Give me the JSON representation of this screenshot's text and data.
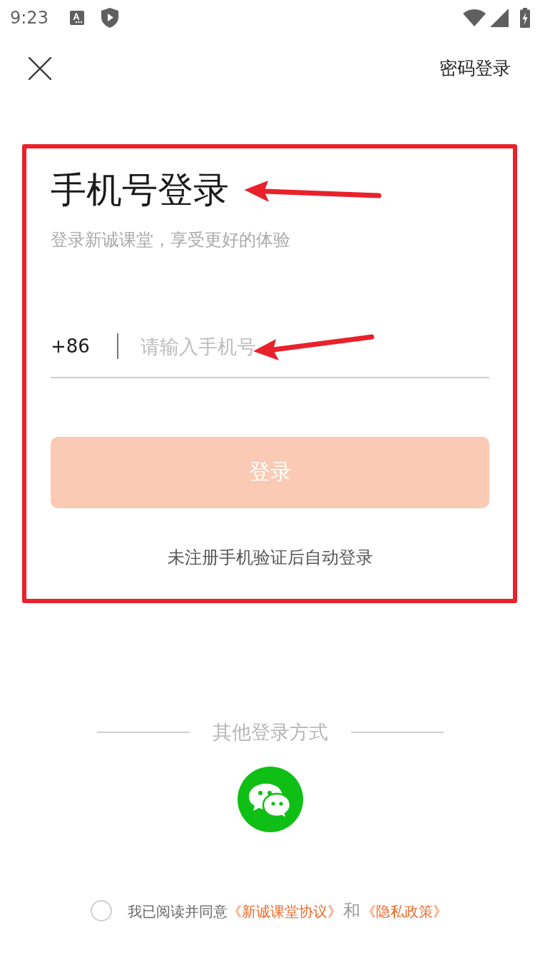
{
  "status_bar": {
    "time": "9:23"
  },
  "top_bar": {
    "password_login": "密码登录"
  },
  "login_card": {
    "highlighted": true,
    "title": "手机号登录",
    "subtitle": "登录新诚课堂，享受更好的体验",
    "country_code": "+86",
    "phone_field": {
      "placeholder": "请输入手机号"
    },
    "login_button": {
      "label": "登录",
      "disabled": true
    },
    "note": "未注册手机验证后自动登录"
  },
  "annotation_arrows": [
    {
      "kind": "arrow"
    },
    {
      "kind": "arrow"
    }
  ],
  "other_login": {
    "title": "其他登录方式"
  },
  "agreement": {
    "checked": false,
    "parts": [
      {
        "kind": "text",
        "text": "我已阅读并同意"
      },
      {
        "kind": "link",
        "text": "《新诚课堂协议》"
      },
      {
        "kind": "conjunction",
        "text": "和"
      },
      {
        "kind": "link",
        "text": "《隐私政策》"
      }
    ]
  }
}
